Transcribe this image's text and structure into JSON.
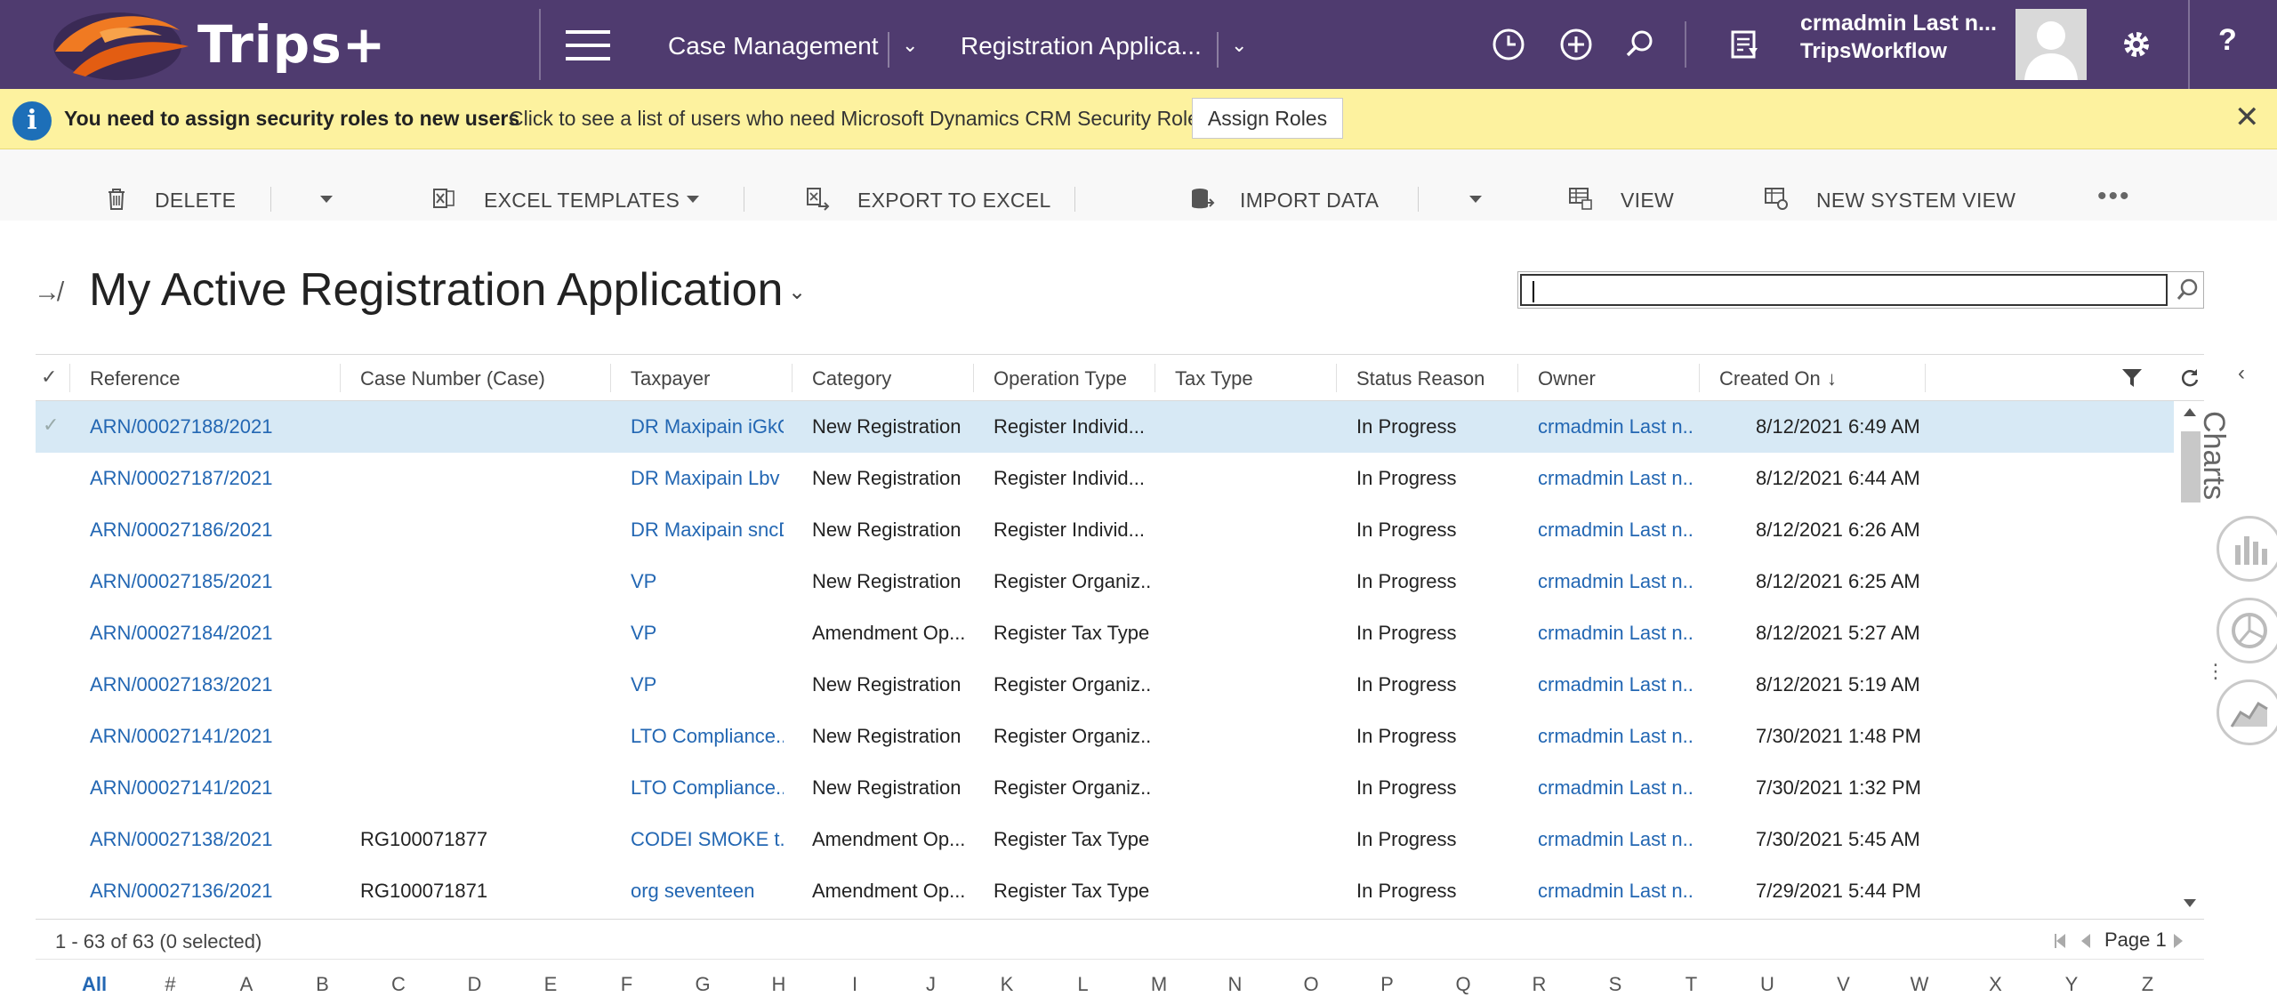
{
  "topnav": {
    "logo_text": "Trips+",
    "area": "Case Management",
    "entity": "Registration Applica...",
    "user_name": "crmadmin Last n...",
    "user_org": "TripsWorkflow",
    "help": "?"
  },
  "notification": {
    "title": "You need to assign security roles to new users",
    "message": "Click to see a list of users who need Microsoft Dynamics CRM Security Roles.",
    "button": "Assign Roles"
  },
  "commands": {
    "delete": "DELETE",
    "excel_templates": "EXCEL TEMPLATES",
    "export": "EXPORT TO EXCEL",
    "import": "IMPORT DATA",
    "view": "VIEW",
    "new_view": "NEW SYSTEM VIEW",
    "more": "•••"
  },
  "view": {
    "title": "My Active Registration Application"
  },
  "columns": {
    "reference": "Reference",
    "case_number": "Case Number (Case)",
    "taxpayer": "Taxpayer",
    "category": "Category",
    "operation_type": "Operation Type",
    "tax_type": "Tax Type",
    "status_reason": "Status Reason",
    "owner": "Owner",
    "created_on": "Created On"
  },
  "rows": [
    {
      "reference": "ARN/00027188/2021",
      "case_number": "",
      "taxpayer": "DR Maxipain iGkO",
      "category": "New Registration",
      "operation_type": "Register Individ...",
      "tax_type": "",
      "status_reason": "In Progress",
      "owner": "crmadmin Last n...",
      "created_on": "8/12/2021 6:49 AM"
    },
    {
      "reference": "ARN/00027187/2021",
      "case_number": "",
      "taxpayer": "DR Maxipain Lbv",
      "category": "New Registration",
      "operation_type": "Register Individ...",
      "tax_type": "",
      "status_reason": "In Progress",
      "owner": "crmadmin Last n...",
      "created_on": "8/12/2021 6:44 AM"
    },
    {
      "reference": "ARN/00027186/2021",
      "case_number": "",
      "taxpayer": "DR Maxipain sncD",
      "category": "New Registration",
      "operation_type": "Register Individ...",
      "tax_type": "",
      "status_reason": "In Progress",
      "owner": "crmadmin Last n...",
      "created_on": "8/12/2021 6:26 AM"
    },
    {
      "reference": "ARN/00027185/2021",
      "case_number": "",
      "taxpayer": "VP",
      "category": "New Registration",
      "operation_type": "Register Organiz...",
      "tax_type": "",
      "status_reason": "In Progress",
      "owner": "crmadmin Last n...",
      "created_on": "8/12/2021 6:25 AM"
    },
    {
      "reference": "ARN/00027184/2021",
      "case_number": "",
      "taxpayer": "VP",
      "category": "Amendment Op...",
      "operation_type": "Register Tax Type",
      "tax_type": "",
      "status_reason": "In Progress",
      "owner": "crmadmin Last n...",
      "created_on": "8/12/2021 5:27 AM"
    },
    {
      "reference": "ARN/00027183/2021",
      "case_number": "",
      "taxpayer": "VP",
      "category": "New Registration",
      "operation_type": "Register Organiz...",
      "tax_type": "",
      "status_reason": "In Progress",
      "owner": "crmadmin Last n...",
      "created_on": "8/12/2021 5:19 AM"
    },
    {
      "reference": "ARN/00027141/2021",
      "case_number": "",
      "taxpayer": "LTO Compliance...",
      "category": "New Registration",
      "operation_type": "Register Organiz...",
      "tax_type": "",
      "status_reason": "In Progress",
      "owner": "crmadmin Last n...",
      "created_on": "7/30/2021 1:48 PM"
    },
    {
      "reference": "ARN/00027141/2021",
      "case_number": "",
      "taxpayer": "LTO Compliance...",
      "category": "New Registration",
      "operation_type": "Register Organiz...",
      "tax_type": "",
      "status_reason": "In Progress",
      "owner": "crmadmin Last n...",
      "created_on": "7/30/2021 1:32 PM"
    },
    {
      "reference": "ARN/00027138/2021",
      "case_number": "RG100071877",
      "taxpayer": "CODEI SMOKE t...",
      "category": "Amendment Op...",
      "operation_type": "Register Tax Type",
      "tax_type": "",
      "status_reason": "In Progress",
      "owner": "crmadmin Last n...",
      "created_on": "7/30/2021 5:45 AM"
    },
    {
      "reference": "ARN/00027136/2021",
      "case_number": "RG100071871",
      "taxpayer": "org seventeen",
      "category": "Amendment Op...",
      "operation_type": "Register Tax Type",
      "tax_type": "",
      "status_reason": "In Progress",
      "owner": "crmadmin Last n...",
      "created_on": "7/29/2021 5:44 PM"
    }
  ],
  "footer": {
    "status": "1 - 63 of 63 (0 selected)",
    "page": "Page 1",
    "alphabet": [
      "All",
      "#",
      "A",
      "B",
      "C",
      "D",
      "E",
      "F",
      "G",
      "H",
      "I",
      "J",
      "K",
      "L",
      "M",
      "N",
      "O",
      "P",
      "Q",
      "R",
      "S",
      "T",
      "U",
      "V",
      "W",
      "X",
      "Y",
      "Z"
    ]
  },
  "rail": {
    "label": "Charts"
  },
  "colors": {
    "nav_bg": "#4f3b6f",
    "notif_bg": "#fdf29f",
    "link": "#2367b3",
    "selected_row": "#d7e9f5"
  }
}
